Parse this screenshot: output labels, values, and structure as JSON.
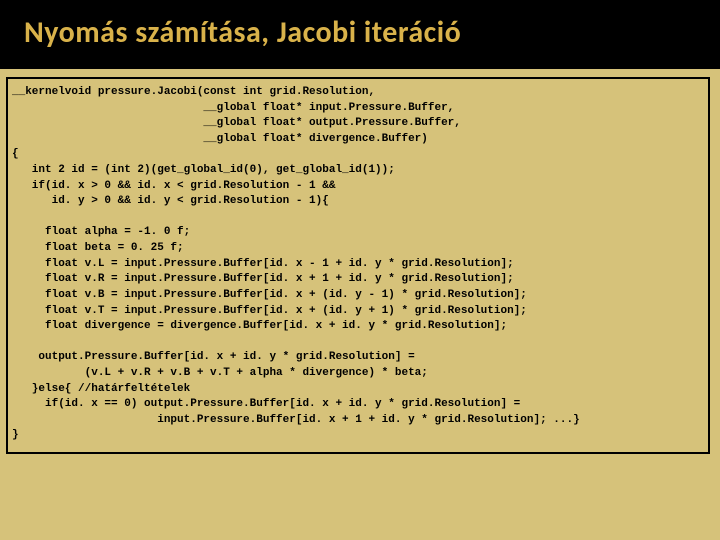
{
  "slide": {
    "title": "Nyomás számítása, Jacobi iteráció"
  },
  "code": {
    "lines": [
      "__kernelvoid pressure.Jacobi(const int grid.Resolution,",
      "                             __global float* input.Pressure.Buffer,",
      "                             __global float* output.Pressure.Buffer,",
      "                             __global float* divergence.Buffer)",
      "{",
      "   int 2 id = (int 2)(get_global_id(0), get_global_id(1));",
      "   if(id. x > 0 && id. x < grid.Resolution - 1 &&",
      "      id. y > 0 && id. y < grid.Resolution - 1){",
      "",
      "     float alpha = -1. 0 f;",
      "     float beta = 0. 25 f;",
      "     float v.L = input.Pressure.Buffer[id. x - 1 + id. y * grid.Resolution];",
      "     float v.R = input.Pressure.Buffer[id. x + 1 + id. y * grid.Resolution];",
      "     float v.B = input.Pressure.Buffer[id. x + (id. y - 1) * grid.Resolution];",
      "     float v.T = input.Pressure.Buffer[id. x + (id. y + 1) * grid.Resolution];",
      "     float divergence = divergence.Buffer[id. x + id. y * grid.Resolution];",
      "",
      "    output.Pressure.Buffer[id. x + id. y * grid.Resolution] =",
      "           (v.L + v.R + v.B + v.T + alpha * divergence) * beta;",
      "   }else{ //határfeltételek",
      "     if(id. x == 0) output.Pressure.Buffer[id. x + id. y * grid.Resolution] =",
      "                      input.Pressure.Buffer[id. x + 1 + id. y * grid.Resolution]; ...}",
      "}"
    ]
  }
}
